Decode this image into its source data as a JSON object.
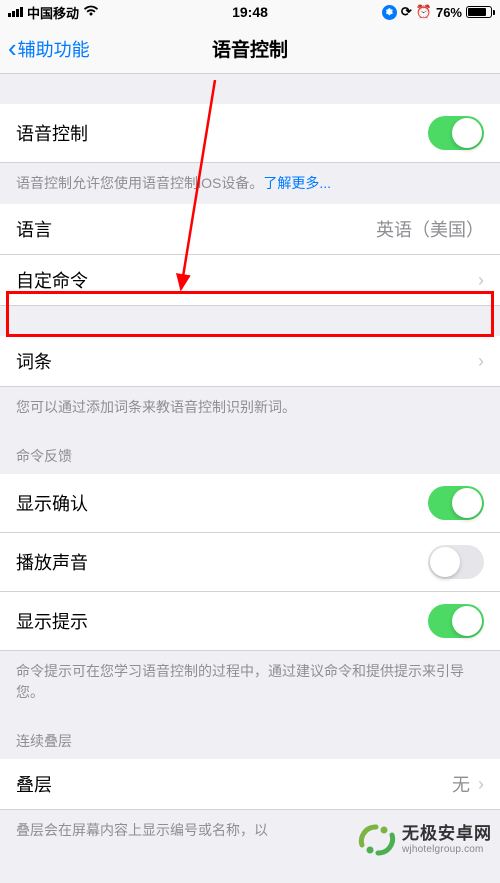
{
  "status": {
    "carrier": "中国移动",
    "time": "19:48",
    "battery": "76%"
  },
  "nav": {
    "back": "辅助功能",
    "title": "语音控制"
  },
  "cells": {
    "voice_control": "语音控制",
    "voice_control_footer": "语音控制允许您使用语音控制iOS设备。",
    "learn_more": "了解更多...",
    "language": "语言",
    "language_value": "英语（美国）",
    "custom_commands": "自定命令",
    "vocabulary": "词条",
    "vocabulary_footer": "您可以通过添加词条来教语音控制识别新词。",
    "command_feedback_header": "命令反馈",
    "show_confirmation": "显示确认",
    "play_sound": "播放声音",
    "show_hints": "显示提示",
    "hints_footer": "命令提示可在您学习语音控制的过程中，通过建议命令和提供提示来引导您。",
    "overlay_header": "连续叠层",
    "overlay": "叠层",
    "overlay_value": "无",
    "overlay_footer": "叠层会在屏幕内容上显示编号或名称，以"
  },
  "watermark": {
    "title": "无极安卓网",
    "url": "wjhotelgroup.com"
  }
}
